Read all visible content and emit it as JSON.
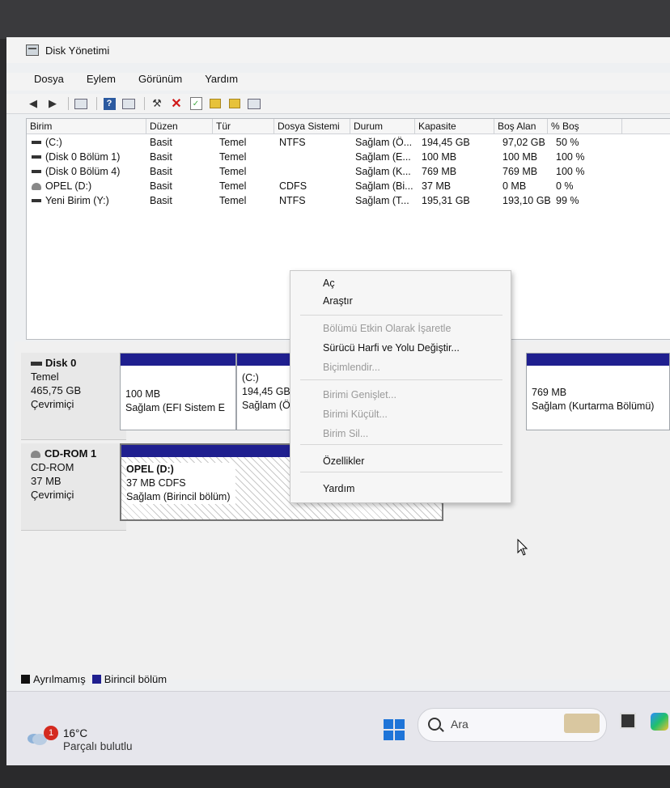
{
  "window": {
    "title": "Disk Yönetimi"
  },
  "menu": [
    "Dosya",
    "Eylem",
    "Görünüm",
    "Yardım"
  ],
  "volumes": {
    "columns": [
      "Birim",
      "Düzen",
      "Tür",
      "Dosya Sistemi",
      "Durum",
      "Kapasite",
      "Boş Alan",
      "% Boş"
    ],
    "rows": [
      {
        "birim": "(C:)",
        "duzen": "Basit",
        "tur": "Temel",
        "fs": "NTFS",
        "durum": "Sağlam (Ö...",
        "kapasite": "194,45 GB",
        "bos": "97,02 GB",
        "yuzde": "50 %",
        "icon": "drive-icon"
      },
      {
        "birim": "(Disk 0 Bölüm 1)",
        "duzen": "Basit",
        "tur": "Temel",
        "fs": "",
        "durum": "Sağlam (E...",
        "kapasite": "100 MB",
        "bos": "100 MB",
        "yuzde": "100 %",
        "icon": "drive-icon"
      },
      {
        "birim": "(Disk 0 Bölüm 4)",
        "duzen": "Basit",
        "tur": "Temel",
        "fs": "",
        "durum": "Sağlam (K...",
        "kapasite": "769 MB",
        "bos": "769 MB",
        "yuzde": "100 %",
        "icon": "drive-icon"
      },
      {
        "birim": "OPEL (D:)",
        "duzen": "Basit",
        "tur": "Temel",
        "fs": "CDFS",
        "durum": "Sağlam (Bi...",
        "kapasite": "37 MB",
        "bos": "0 MB",
        "yuzde": "0 %",
        "icon": "cd-icon"
      },
      {
        "birim": "Yeni Birim (Y:)",
        "duzen": "Basit",
        "tur": "Temel",
        "fs": "NTFS",
        "durum": "Sağlam (T...",
        "kapasite": "195,31 GB",
        "bos": "193,10 GB",
        "yuzde": "99 %",
        "icon": "drive-icon"
      }
    ]
  },
  "disk0": {
    "name": "Disk 0",
    "type": "Temel",
    "size": "465,75 GB",
    "status": "Çevrimiçi",
    "p1": {
      "line1": "100 MB",
      "line2": "Sağlam (EFI Sistem E"
    },
    "p2": {
      "line0": "(C:)",
      "line1": "194,45 GB",
      "line2": "Sağlam (Ö"
    },
    "p4": {
      "line1": "769 MB",
      "line2": "Sağlam (Kurtarma Bölümü)"
    }
  },
  "cdrom1": {
    "name": "CD-ROM 1",
    "type": "CD-ROM",
    "size": "37 MB",
    "status": "Çevrimiçi",
    "p1": {
      "line0": "OPEL (D:)",
      "line1": "37 MB CDFS",
      "line2": "Sağlam (Birincil bölüm)"
    }
  },
  "legend": {
    "unallocated": "Ayrılmamış",
    "primary": "Birincil bölüm"
  },
  "context_menu": {
    "open": "Aç",
    "explore": "Araştır",
    "mark_active": "Bölümü Etkin Olarak İşaretle",
    "change_letter": "Sürücü Harfi ve Yolu Değiştir...",
    "format": "Biçimlendir...",
    "extend": "Birimi Genişlet...",
    "shrink": "Birimi Küçült...",
    "delete": "Birim Sil...",
    "properties": "Özellikler",
    "help": "Yardım"
  },
  "taskbar": {
    "weather_badge": "1",
    "temperature": "16°C",
    "condition": "Parçalı bulutlu",
    "search": "Ara"
  },
  "colors": {
    "primary_partition": "#1f1f8f",
    "unallocated": "#111111"
  }
}
